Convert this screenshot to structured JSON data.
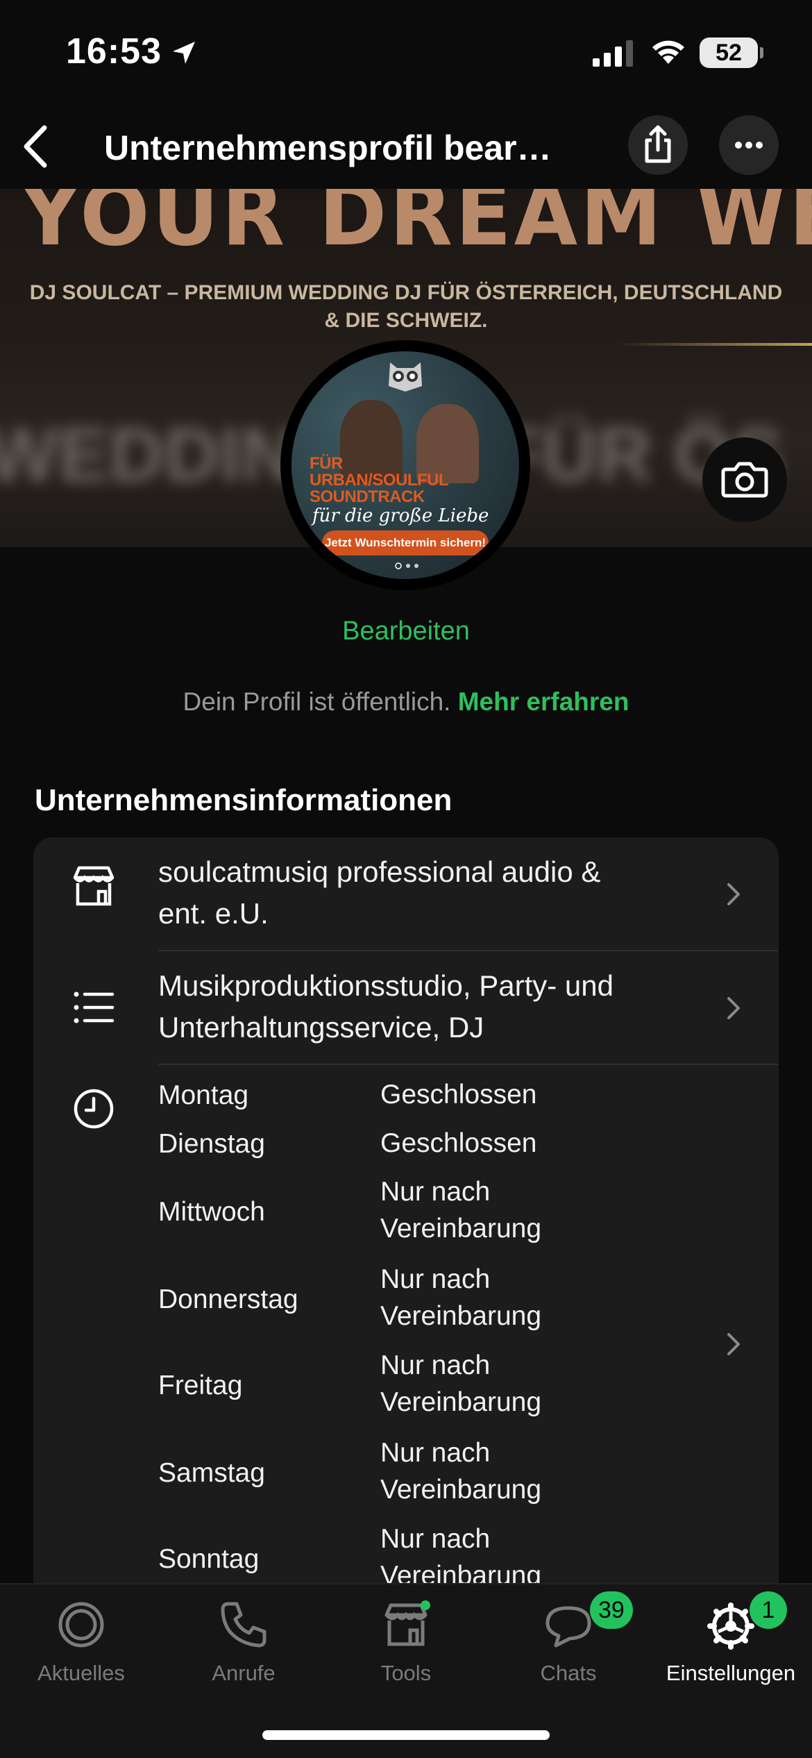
{
  "status_bar": {
    "time": "16:53",
    "battery": "52",
    "icons": [
      "location-arrow-icon",
      "signal-icon",
      "wifi-icon",
      "battery-icon"
    ]
  },
  "nav": {
    "title": "Unternehmensprofil bear…",
    "icons": [
      "back-chevron-icon",
      "share-icon",
      "more-dots-icon"
    ]
  },
  "cover": {
    "headline": "YOUR DREAM WEDDING",
    "subtitle_line1": "DJ SOULCAT – PREMIUM WEDDING DJ FÜR ÖSTERREICH, DEUTSCHLAND",
    "subtitle_line2": "& DIE SCHWEIZ.",
    "background_text": "WEDDING DJ FÜR ÖS"
  },
  "avatar": {
    "promo_line1": "FÜR",
    "promo_line2": "URBAN/SOULFUL",
    "promo_line3": "SOUNDTRACK",
    "promo_tagline": "für die große Liebe",
    "cta": "Jetzt Wunschtermin sichern!"
  },
  "profile": {
    "edit_label": "Bearbeiten",
    "public_note": "Dein Profil ist öffentlich.",
    "learn_more": "Mehr erfahren"
  },
  "business_info": {
    "section_title": "Unternehmensinformationen",
    "name_line1": "soulcatmusiq professional audio &",
    "name_line2": "ent. e.U.",
    "category_line1": "Musikproduktionsstudio, Party- und",
    "category_line2": "Unterhaltungsservice, DJ",
    "hours": [
      {
        "day": "Montag",
        "value": "Geschlossen"
      },
      {
        "day": "Dienstag",
        "value": "Geschlossen"
      },
      {
        "day": "Mittwoch",
        "value": "Nur nach Vereinbarung"
      },
      {
        "day": "Donnerstag",
        "value": "Nur nach Vereinbarung"
      },
      {
        "day": "Freitag",
        "value": "Nur nach Vereinbarung"
      },
      {
        "day": "Samstag",
        "value": "Nur nach Vereinbarung"
      },
      {
        "day": "Sonntag",
        "value": "Nur nach Vereinbarung"
      }
    ]
  },
  "tab_bar": {
    "tabs": [
      {
        "label": "Aktuelles",
        "icon": "updates-icon"
      },
      {
        "label": "Anrufe",
        "icon": "phone-icon"
      },
      {
        "label": "Tools",
        "icon": "store-icon"
      },
      {
        "label": "Chats",
        "icon": "chat-bubbles-icon",
        "badge": "39"
      },
      {
        "label": "Einstellungen",
        "icon": "settings-gear-icon",
        "badge": "1"
      }
    ]
  },
  "colors": {
    "accent_green": "#2fbf5f",
    "badge_green": "#22c35e",
    "background": "#0b0b0b",
    "card": "#1c1c1c"
  }
}
